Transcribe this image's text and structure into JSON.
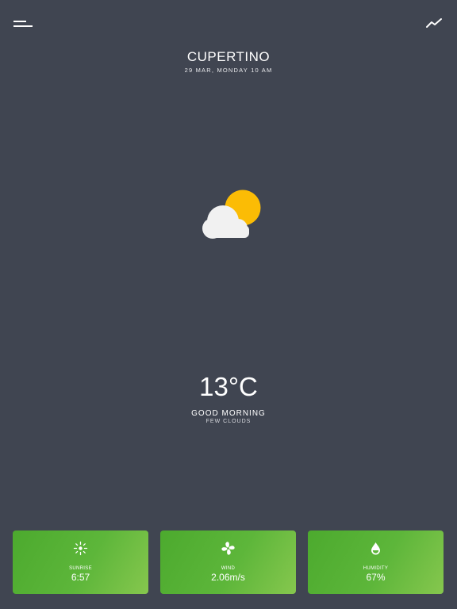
{
  "header": {
    "menu_icon": "menu-icon",
    "chart_icon": "trend-chart-icon"
  },
  "location": {
    "city": "CUPERTINO",
    "datetime": "29 MAR, MONDAY 10 AM"
  },
  "weather": {
    "icon": "partly-cloudy-icon",
    "temperature": "13°C",
    "greeting": "GOOD MORNING",
    "condition": "FEW CLOUDS"
  },
  "cards": [
    {
      "label": "SUNRISE",
      "value": "6:57",
      "icon": "sunrise-icon"
    },
    {
      "label": "WIND",
      "value": "2.06m/s",
      "icon": "wind-fan-icon"
    },
    {
      "label": "HUMIDITY",
      "value": "67%",
      "icon": "humidity-drop-icon"
    }
  ],
  "colors": {
    "background": "#404551",
    "card_green": "#5db63a",
    "sun": "#fbbc05",
    "cloud": "#f1f1f1"
  }
}
